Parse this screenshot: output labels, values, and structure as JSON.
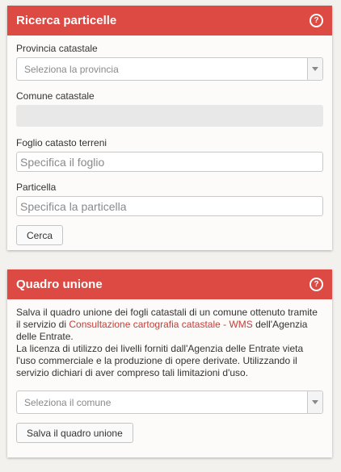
{
  "ricerca": {
    "title": "Ricerca particelle",
    "provincia_label": "Provincia catastale",
    "provincia_placeholder": "Seleziona la provincia",
    "comune_label": "Comune catastale",
    "foglio_label": "Foglio catasto terreni",
    "foglio_placeholder": "Specifica il foglio",
    "particella_label": "Particella",
    "particella_placeholder": "Specifica la particella",
    "search_button": "Cerca"
  },
  "quadro": {
    "title": "Quadro unione",
    "description_before": "Salva il quadro unione dei fogli catastali di un comune ottenuto tramite il servizio di ",
    "link_text": "Consultazione cartografia catastale - WMS",
    "description_after": " dell'Agenzia delle Entrate.",
    "license_text": "La licenza di utilizzo dei livelli forniti dall'Agenzia delle Entrate vieta l'uso commerciale e la produzione di opere derivate. Utilizzando il servizio dichiari di aver compreso tali limitazioni d'uso.",
    "comune_placeholder": "Seleziona il comune",
    "save_button": "Salva il quadro unione"
  },
  "icons": {
    "help": "help-icon",
    "dropdown": "chevron-down-icon"
  },
  "colors": {
    "header": "#dc4a43",
    "link": "#c0403a"
  }
}
